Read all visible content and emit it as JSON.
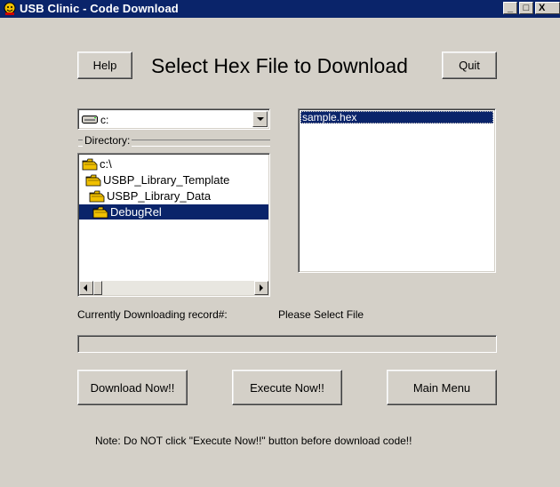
{
  "window": {
    "title": "USB Clinic - Code Download",
    "controls": {
      "minimize": "_",
      "maximize": "□",
      "close": "X"
    }
  },
  "header": {
    "help_label": "Help",
    "heading": "Select Hex File to Download",
    "quit_label": "Quit"
  },
  "drive_combo": {
    "value": "c:",
    "icon": "drive-icon"
  },
  "directory": {
    "group_label": "Directory:",
    "items": [
      {
        "label": "c:\\",
        "icon": "open-folder-icon"
      },
      {
        "label": "USBP_Library_Template",
        "icon": "open-folder-icon"
      },
      {
        "label": "USBP_Library_Data",
        "icon": "open-folder-icon"
      },
      {
        "label": "DebugRel",
        "icon": "open-folder-icon",
        "selected": true
      }
    ]
  },
  "file_list": {
    "items": [
      {
        "label": "sample.hex",
        "selected": true
      }
    ]
  },
  "status": {
    "record_label": "Currently Downloading record#:",
    "record_value": "Please Select File",
    "progress": 0
  },
  "actions": {
    "download_label": "Download Now!!",
    "execute_label": "Execute Now!!",
    "main_menu_label": "Main Menu"
  },
  "note": "Note: Do NOT click \"Execute Now!!\" button before download code!!",
  "colors": {
    "face": "#d4d0c8",
    "selection": "#0a246a",
    "folder": "#f0c000"
  }
}
